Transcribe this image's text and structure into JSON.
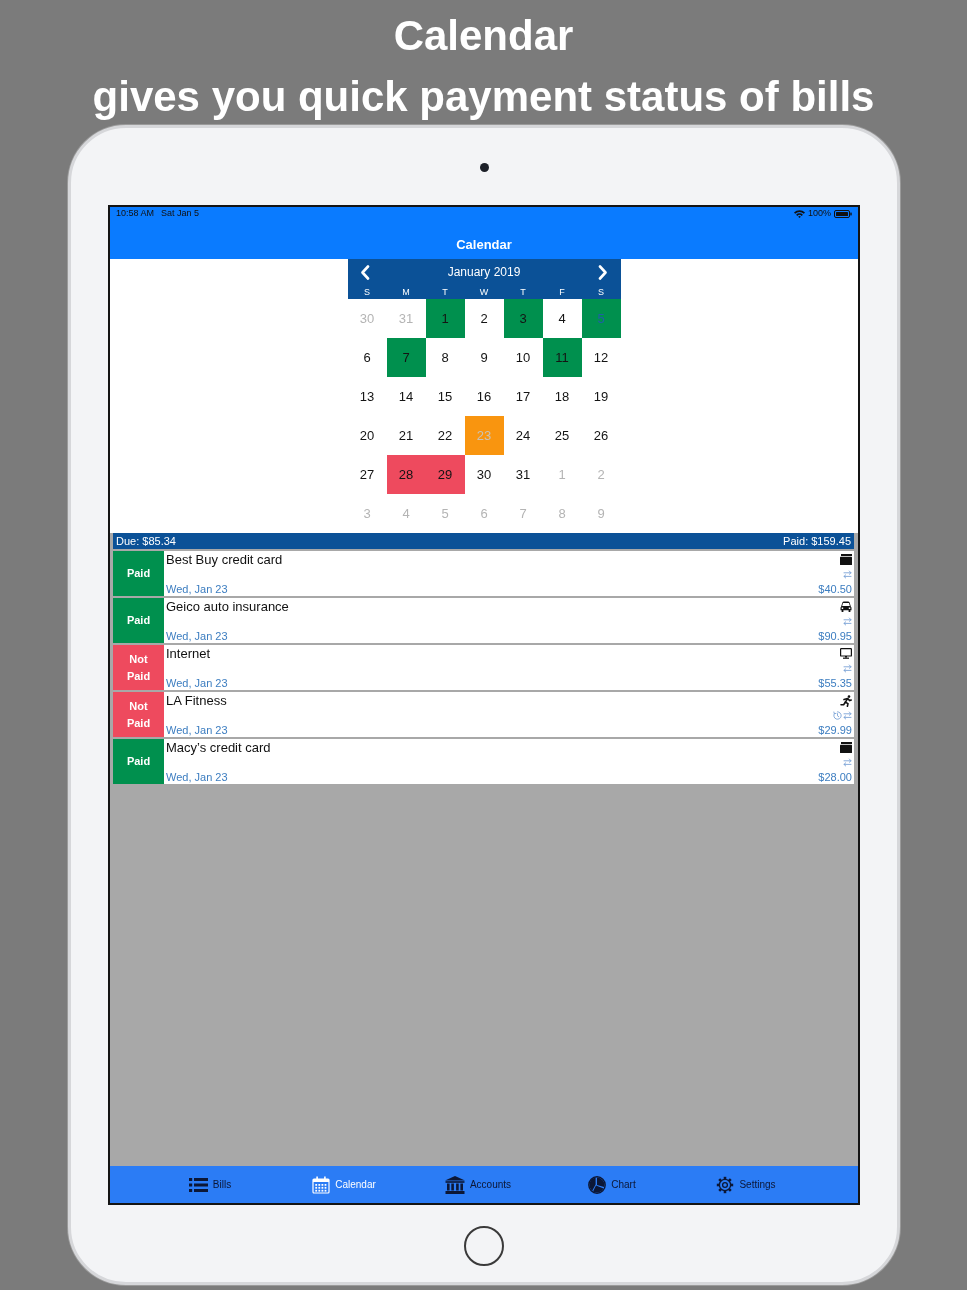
{
  "caption": {
    "title": "Calendar",
    "subtitle": "gives you quick payment status of bills"
  },
  "status_bar": {
    "time": "10:58 AM",
    "date": "Sat Jan 5",
    "battery": "100%"
  },
  "nav": {
    "title": "Calendar"
  },
  "calendar": {
    "month": "January 2019",
    "weekdays": [
      "S",
      "M",
      "T",
      "W",
      "T",
      "F",
      "S"
    ],
    "days": [
      {
        "day": "30",
        "in_month": false,
        "kind": "plain",
        "selected": false,
        "today": false
      },
      {
        "day": "31",
        "in_month": false,
        "kind": "plain",
        "selected": false,
        "today": false
      },
      {
        "day": "1",
        "in_month": true,
        "kind": "paid",
        "selected": false,
        "today": false
      },
      {
        "day": "2",
        "in_month": true,
        "kind": "plain",
        "selected": false,
        "today": false
      },
      {
        "day": "3",
        "in_month": true,
        "kind": "paid",
        "selected": false,
        "today": false
      },
      {
        "day": "4",
        "in_month": true,
        "kind": "plain",
        "selected": false,
        "today": false
      },
      {
        "day": "5",
        "in_month": true,
        "kind": "paid",
        "selected": false,
        "today": true
      },
      {
        "day": "6",
        "in_month": true,
        "kind": "plain",
        "selected": false,
        "today": false
      },
      {
        "day": "7",
        "in_month": true,
        "kind": "paid",
        "selected": false,
        "today": false
      },
      {
        "day": "8",
        "in_month": true,
        "kind": "plain",
        "selected": false,
        "today": false
      },
      {
        "day": "9",
        "in_month": true,
        "kind": "plain",
        "selected": false,
        "today": false
      },
      {
        "day": "10",
        "in_month": true,
        "kind": "plain",
        "selected": false,
        "today": false
      },
      {
        "day": "11",
        "in_month": true,
        "kind": "paid",
        "selected": false,
        "today": false
      },
      {
        "day": "12",
        "in_month": true,
        "kind": "plain",
        "selected": false,
        "today": false
      },
      {
        "day": "13",
        "in_month": true,
        "kind": "plain",
        "selected": false,
        "today": false
      },
      {
        "day": "14",
        "in_month": true,
        "kind": "plain",
        "selected": false,
        "today": false
      },
      {
        "day": "15",
        "in_month": true,
        "kind": "plain",
        "selected": false,
        "today": false
      },
      {
        "day": "16",
        "in_month": true,
        "kind": "plain",
        "selected": false,
        "today": false
      },
      {
        "day": "17",
        "in_month": true,
        "kind": "plain",
        "selected": false,
        "today": false
      },
      {
        "day": "18",
        "in_month": true,
        "kind": "plain",
        "selected": false,
        "today": false
      },
      {
        "day": "19",
        "in_month": true,
        "kind": "plain",
        "selected": false,
        "today": false
      },
      {
        "day": "20",
        "in_month": true,
        "kind": "plain",
        "selected": false,
        "today": false
      },
      {
        "day": "21",
        "in_month": true,
        "kind": "plain",
        "selected": false,
        "today": false
      },
      {
        "day": "22",
        "in_month": true,
        "kind": "plain",
        "selected": false,
        "today": false
      },
      {
        "day": "23",
        "in_month": true,
        "kind": "mixed",
        "selected": true,
        "today": false
      },
      {
        "day": "24",
        "in_month": true,
        "kind": "plain",
        "selected": false,
        "today": false
      },
      {
        "day": "25",
        "in_month": true,
        "kind": "plain",
        "selected": false,
        "today": false
      },
      {
        "day": "26",
        "in_month": true,
        "kind": "plain",
        "selected": false,
        "today": false
      },
      {
        "day": "27",
        "in_month": true,
        "kind": "plain",
        "selected": false,
        "today": false
      },
      {
        "day": "28",
        "in_month": true,
        "kind": "unpaid",
        "selected": false,
        "today": false
      },
      {
        "day": "29",
        "in_month": true,
        "kind": "unpaid",
        "selected": false,
        "today": false
      },
      {
        "day": "30",
        "in_month": true,
        "kind": "plain",
        "selected": false,
        "today": false
      },
      {
        "day": "31",
        "in_month": true,
        "kind": "plain",
        "selected": false,
        "today": false
      },
      {
        "day": "1",
        "in_month": false,
        "kind": "plain",
        "selected": false,
        "today": false
      },
      {
        "day": "2",
        "in_month": false,
        "kind": "plain",
        "selected": false,
        "today": false
      },
      {
        "day": "3",
        "in_month": false,
        "kind": "plain",
        "selected": false,
        "today": false
      },
      {
        "day": "4",
        "in_month": false,
        "kind": "plain",
        "selected": false,
        "today": false
      },
      {
        "day": "5",
        "in_month": false,
        "kind": "plain",
        "selected": false,
        "today": false
      },
      {
        "day": "6",
        "in_month": false,
        "kind": "plain",
        "selected": false,
        "today": false
      },
      {
        "day": "7",
        "in_month": false,
        "kind": "plain",
        "selected": false,
        "today": false
      },
      {
        "day": "8",
        "in_month": false,
        "kind": "plain",
        "selected": false,
        "today": false
      },
      {
        "day": "9",
        "in_month": false,
        "kind": "plain",
        "selected": false,
        "today": false
      }
    ]
  },
  "summary": {
    "due": "Due: $85.34",
    "paid": "Paid: $159.45"
  },
  "bills": [
    {
      "status_label": "Paid",
      "paid": true,
      "name": "Best Buy credit card",
      "date": "Wed, Jan 23",
      "kind": "card",
      "repeat": true,
      "reminder": false,
      "amount": "$40.50"
    },
    {
      "status_label": "Paid",
      "paid": true,
      "name": "Geico auto insurance",
      "date": "Wed, Jan 23",
      "kind": "car",
      "repeat": true,
      "reminder": false,
      "amount": "$90.95"
    },
    {
      "status_label": "Not Paid",
      "paid": false,
      "name": "Internet",
      "date": "Wed, Jan 23",
      "kind": "monitor",
      "repeat": true,
      "reminder": false,
      "amount": "$55.35"
    },
    {
      "status_label": "Not Paid",
      "paid": false,
      "name": "LA Fitness",
      "date": "Wed, Jan 23",
      "kind": "runner",
      "repeat": true,
      "reminder": true,
      "amount": "$29.99"
    },
    {
      "status_label": "Paid",
      "paid": true,
      "name": "Macy’s credit card",
      "date": "Wed, Jan 23",
      "kind": "card",
      "repeat": true,
      "reminder": false,
      "amount": "$28.00"
    }
  ],
  "tabs": [
    {
      "label": "Bills",
      "kind": "list",
      "selected": false
    },
    {
      "label": "Calendar",
      "kind": "calendar",
      "selected": true
    },
    {
      "label": "Accounts",
      "kind": "bank",
      "selected": false
    },
    {
      "label": "Chart",
      "kind": "pie",
      "selected": false
    },
    {
      "label": "Settings",
      "kind": "gear",
      "selected": false
    }
  ]
}
